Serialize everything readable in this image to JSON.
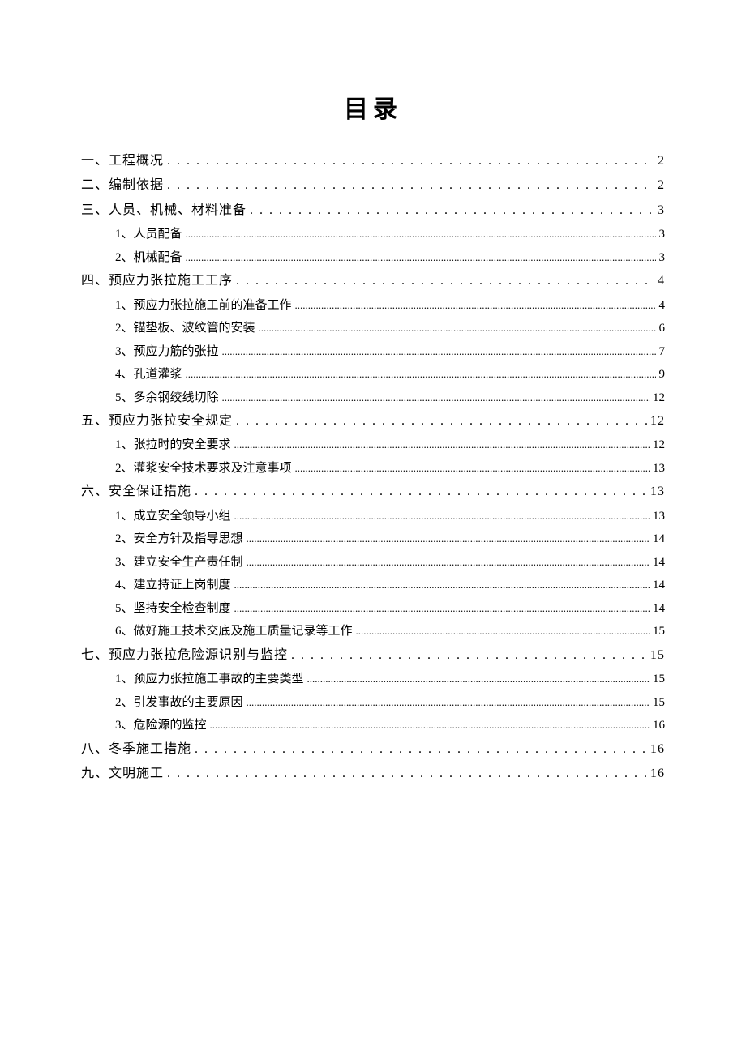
{
  "title": "目录",
  "toc": [
    {
      "level": 1,
      "label": "一、工程概况",
      "page": "2"
    },
    {
      "level": 1,
      "label": "二、编制依据",
      "page": "2"
    },
    {
      "level": 1,
      "label": "三、人员、机械、材料准备",
      "page": "3"
    },
    {
      "level": 2,
      "label": "1、人员配备",
      "page": "3"
    },
    {
      "level": 2,
      "label": "2、机械配备",
      "page": "3"
    },
    {
      "level": 1,
      "label": "四、预应力张拉施工工序",
      "page": "4"
    },
    {
      "level": 2,
      "label": "1、预应力张拉施工前的准备工作",
      "page": "4"
    },
    {
      "level": 2,
      "label": "2、锚垫板、波纹管的安装",
      "page": "6"
    },
    {
      "level": 2,
      "label": "3、预应力筋的张拉",
      "page": "7"
    },
    {
      "level": 2,
      "label": "4、孔道灌浆",
      "page": "9"
    },
    {
      "level": 2,
      "label": "5、多余钢绞线切除",
      "page": "12"
    },
    {
      "level": 1,
      "label": "五、预应力张拉安全规定",
      "page": "12"
    },
    {
      "level": 2,
      "label": "1、张拉时的安全要求",
      "page": "12"
    },
    {
      "level": 2,
      "label": "2、灌浆安全技术要求及注意事项",
      "page": "13"
    },
    {
      "level": 1,
      "label": "六、安全保证措施",
      "page": "13"
    },
    {
      "level": 2,
      "label": "1、成立安全领导小组",
      "page": "13"
    },
    {
      "level": 2,
      "label": "2、安全方针及指导思想",
      "page": "14"
    },
    {
      "level": 2,
      "label": "3、建立安全生产责任制",
      "page": "14"
    },
    {
      "level": 2,
      "label": "4、建立持证上岗制度",
      "page": "14"
    },
    {
      "level": 2,
      "label": "5、坚持安全检查制度",
      "page": "14"
    },
    {
      "level": 2,
      "label": "6、做好施工技术交底及施工质量记录等工作",
      "page": "15"
    },
    {
      "level": 1,
      "label": "七、预应力张拉危险源识别与监控",
      "page": "15"
    },
    {
      "level": 2,
      "label": "1、预应力张拉施工事故的主要类型",
      "page": "15"
    },
    {
      "level": 2,
      "label": "2、引发事故的主要原因",
      "page": "15"
    },
    {
      "level": 2,
      "label": "3、危险源的监控",
      "page": "16"
    },
    {
      "level": 1,
      "label": "八、冬季施工措施",
      "page": "16"
    },
    {
      "level": 1,
      "label": "九、文明施工",
      "page": "16"
    }
  ]
}
